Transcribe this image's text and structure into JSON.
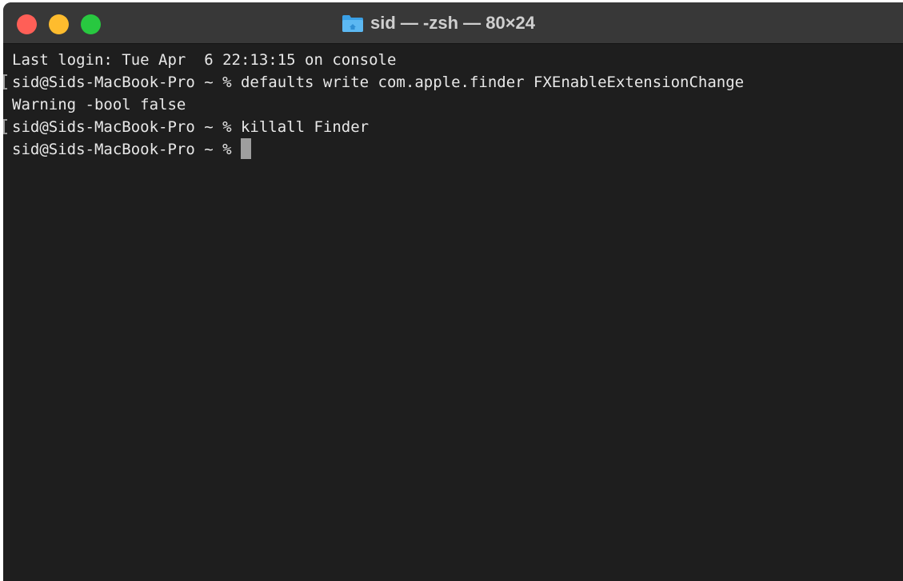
{
  "window": {
    "title": "sid — -zsh — 80×24",
    "folder_icon": "folder-icon",
    "traffic_lights": {
      "close_color": "#ff5f57",
      "minimize_color": "#febc2e",
      "zoom_color": "#28c840"
    }
  },
  "terminal": {
    "lines": [
      {
        "text": "Last login: Tue Apr  6 22:13:15 on console",
        "marked": false
      },
      {
        "text": "sid@Sids-MacBook-Pro ~ % defaults write com.apple.finder FXEnableExtensionChange",
        "marked": true
      },
      {
        "text": "Warning -bool false",
        "marked": false
      },
      {
        "text": "sid@Sids-MacBook-Pro ~ % killall Finder",
        "marked": true
      },
      {
        "text": "sid@Sids-MacBook-Pro ~ % ",
        "marked": false
      }
    ],
    "cursor": "block-cursor"
  }
}
